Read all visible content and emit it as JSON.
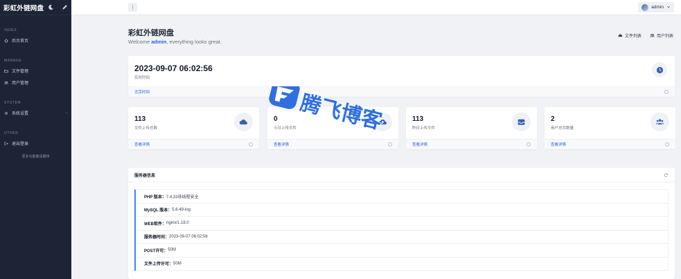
{
  "sidebar": {
    "brand": "彩虹外链网盘",
    "sections": [
      {
        "title": "INDEX",
        "items": [
          {
            "label": "后台首页",
            "icon": "home-icon"
          }
        ]
      },
      {
        "title": "MANAGE",
        "items": [
          {
            "label": "文件管理",
            "icon": "folder-icon"
          },
          {
            "label": "用户管理",
            "icon": "users-icon"
          }
        ]
      },
      {
        "title": "SYSTEM",
        "items": [
          {
            "label": "系统设置",
            "icon": "gear-icon",
            "chevron": "‹"
          }
        ]
      },
      {
        "title": "OTHER",
        "items": [
          {
            "label": "退出登录",
            "icon": "logout-icon"
          }
        ]
      }
    ],
    "note": "更多功能敬请期待"
  },
  "topbar": {
    "menu_glyph": "⋮",
    "user": "admin"
  },
  "header": {
    "title": "彩虹外链网盘",
    "welcome_prefix": "Welcome ",
    "welcome_user": "admin",
    "welcome_suffix": ", everything looks great.",
    "links": [
      "文件列表",
      "用户列表"
    ]
  },
  "time_card": {
    "value": "2023-09-07 06:02:56",
    "label": "实时时间",
    "footer_link": "北京时间"
  },
  "stats": [
    {
      "value": "113",
      "label": "文件上传总数",
      "link": "查看详情",
      "icon": "cloud-icon"
    },
    {
      "value": "0",
      "label": "今日上传文件",
      "link": "查看详情",
      "icon": "cloud-upload-icon"
    },
    {
      "value": "113",
      "label": "昨日上传文件",
      "link": "查看详情",
      "icon": "inbox-icon"
    },
    {
      "value": "2",
      "label": "用户总共数量",
      "link": "查看详情",
      "icon": "users-icon"
    }
  ],
  "server": {
    "title": "服务器信息",
    "rows": [
      {
        "key": "PHP 版本：",
        "value": "7.4.33非线程安全"
      },
      {
        "key": "MySQL 版本：",
        "value": "5.6.49-log"
      },
      {
        "key": "WEB软件：",
        "value": "nginx/1.18.0"
      },
      {
        "key": "服务器时间：",
        "value": "2023-09-07 06:02:56"
      },
      {
        "key": "POST许可：",
        "value": "50M"
      },
      {
        "key": "文件上传许可：",
        "value": "50M"
      }
    ]
  },
  "watermark": {
    "text": "腾飞博客"
  },
  "colors": {
    "sidebar_bg": "#1c2435",
    "accent": "#2563eb",
    "page_bg": "#f0f2f5",
    "icon_color": "#3b5fb0"
  }
}
